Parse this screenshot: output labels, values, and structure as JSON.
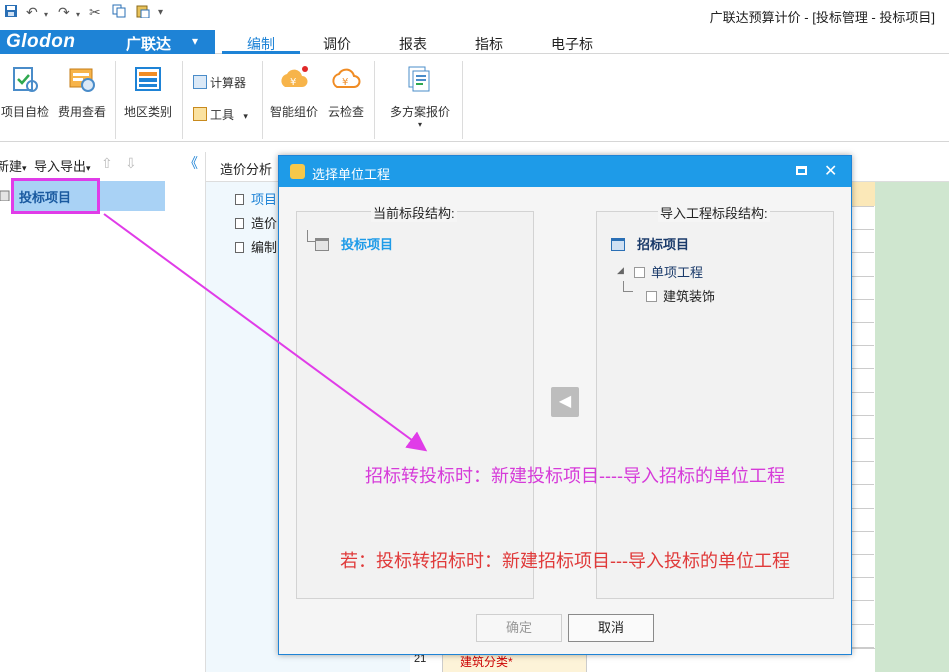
{
  "window": {
    "title": "广联达预算计价 - [投标管理 - 投标项目]"
  },
  "quick_access": {
    "save": "save-icon",
    "undo": "undo-icon",
    "redo": "redo-icon",
    "cut": "cut-icon",
    "copy": "copy-icon",
    "paste": "paste-icon",
    "more": "▾"
  },
  "brand": {
    "logo": "Glodon",
    "name_cn": "广联达",
    "dropdown": "▾"
  },
  "ribbon_tabs": [
    {
      "label": "编制",
      "active": true
    },
    {
      "label": "调价",
      "active": false
    },
    {
      "label": "报表",
      "active": false
    },
    {
      "label": "指标",
      "active": false
    },
    {
      "label": "电子标",
      "active": false
    }
  ],
  "ribbon": {
    "project_check": "项目自检",
    "fee_view": "费用查看",
    "region_type": "地区类别",
    "calculator": "计算器",
    "tools": "工具",
    "tools_caret": "▾",
    "smart_price": "智能组价",
    "cloud_check": "云检查",
    "multi_quote": "多方案报价",
    "multi_quote_caret": "▾"
  },
  "left_toolbar": {
    "new": "新建",
    "new_caret": "▾",
    "import_export": "导入导出",
    "import_caret": "▾",
    "up": "⇧",
    "down": "⇩",
    "collapse": "《"
  },
  "left_tree": {
    "selected": "投标项目"
  },
  "mid_tabs": {
    "cost_analysis": "造价分析"
  },
  "mid_docs": [
    "项目",
    "造价",
    "编制"
  ],
  "grid": {
    "row_number": "21",
    "row_text": "建筑分类*"
  },
  "dialog": {
    "title": "选择单位工程",
    "left_caption": "当前标段结构:",
    "left_root": "投标项目",
    "right_caption": "导入工程标段结构:",
    "right_root": "招标项目",
    "right_child": "单项工程",
    "right_grandchild": "建筑装饰",
    "move_button": "◀",
    "confirm": "确定",
    "cancel": "取消"
  },
  "annotations": {
    "pink": "招标转投标时：新建投标项目----导入招标的单位工程",
    "red": "若：投标转招标时：新建招标项目---导入投标的单位工程",
    "pink_color": "#d63bd9",
    "red_color": "#e03a3a"
  }
}
